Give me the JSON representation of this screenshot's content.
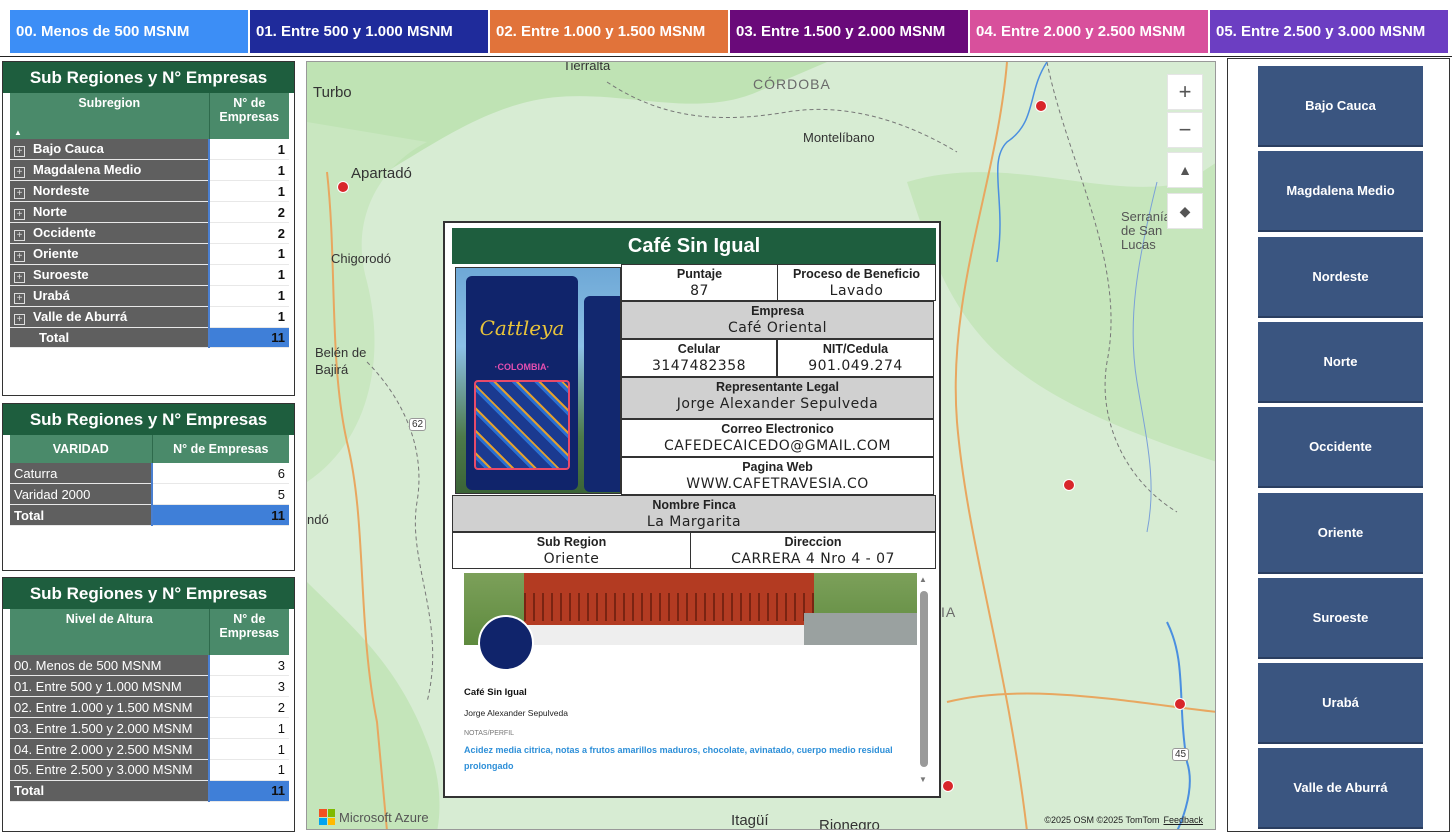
{
  "legend": [
    {
      "label": "00. Menos de 500 MSNM",
      "color": "#3c8ef6"
    },
    {
      "label": "01. Entre 500 y 1.000 MSNM",
      "color": "#1f2b9b"
    },
    {
      "label": "02. Entre 1.000 y 1.500 MSNM",
      "color": "#e1733a"
    },
    {
      "label": "03. Entre 1.500 y 2.000 MSNM",
      "color": "#6a0a7a"
    },
    {
      "label": "04. Entre 2.000 y 2.500 MSNM",
      "color": "#d8509c"
    },
    {
      "label": "05. Entre 2.500 y 3.000 MSNM",
      "color": "#6c3ec2"
    }
  ],
  "table1": {
    "title": "Sub Regiones y N° Empresas",
    "col1": "Subregion",
    "col2": "N° de Empresas",
    "rows": [
      {
        "label": "Bajo Cauca",
        "value": "1"
      },
      {
        "label": "Magdalena Medio",
        "value": "1"
      },
      {
        "label": "Nordeste",
        "value": "1"
      },
      {
        "label": "Norte",
        "value": "2"
      },
      {
        "label": "Occidente",
        "value": "2"
      },
      {
        "label": "Oriente",
        "value": "1"
      },
      {
        "label": "Suroeste",
        "value": "1"
      },
      {
        "label": "Urabá",
        "value": "1"
      },
      {
        "label": "Valle de Aburrá",
        "value": "1"
      }
    ],
    "total_label": "Total",
    "total_value": "11"
  },
  "table2": {
    "title": "Sub Regiones y N° Empresas",
    "col1": "VARIDAD",
    "col2": "N° de Empresas",
    "rows": [
      {
        "label": "Caturra",
        "value": "6"
      },
      {
        "label": "Varidad 2000",
        "value": "5"
      }
    ],
    "total_label": "Total",
    "total_value": "11"
  },
  "table3": {
    "title": "Sub Regiones y N° Empresas",
    "col1": "Nivel de Altura",
    "col2": "N° de Empresas",
    "rows": [
      {
        "label": "00. Menos de 500 MSNM",
        "value": "3"
      },
      {
        "label": "01. Entre 500 y 1.000 MSNM",
        "value": "3"
      },
      {
        "label": "02. Entre 1.000 y 1.500 MSNM",
        "value": "2"
      },
      {
        "label": "03. Entre 1.500 y 2.000 MSNM",
        "value": "1"
      },
      {
        "label": "04. Entre 2.000 y 2.500 MSNM",
        "value": "1"
      },
      {
        "label": "05. Entre 2.500 y 3.000 MSNM",
        "value": "1"
      }
    ],
    "total_label": "Total",
    "total_value": "11"
  },
  "map": {
    "labels": {
      "tierralta": "Tierralta",
      "cordoba": "CÓRDOBA",
      "turbo": "Turbo",
      "montelibano": "Montelíbano",
      "apartado": "Apartadó",
      "chigorodo": "Chigorodó",
      "belen": "Belén de Bajirá",
      "serrania": "Serranía de San Lucas",
      "route62": "62",
      "route45": "45",
      "ndo": "ndó",
      "ia": "IA",
      "itagui": "Itagüí",
      "rionegro": "Rionegro"
    },
    "zoom_in": "+",
    "zoom_out": "−",
    "attribution": "©2025 OSM  ©2025 TomTom",
    "feedback": "Feedback",
    "provider": "Microsoft Azure"
  },
  "card": {
    "title": "Café Sin Igual",
    "puntaje_label": "Puntaje",
    "puntaje": "87",
    "proceso_label": "Proceso de Beneficio",
    "proceso": "Lavado",
    "empresa_label": "Empresa",
    "empresa": "Café Oriental",
    "celular_label": "Celular",
    "celular": "3147482358",
    "nit_label": "NIT/Cedula",
    "nit": "901.049.274",
    "rep_label": "Representante Legal",
    "rep": "Jorge Alexander Sepulveda",
    "correo_label": "Correo Electronico",
    "correo": "CAFEDECAICEDO@GMAIL.COM",
    "web_label": "Pagina Web",
    "web": "WWW.CAFETRAVESIA.CO",
    "finca_label": "Nombre Finca",
    "finca": "La Margarita",
    "subregion_label": "Sub Region",
    "subregion": "Oriente",
    "direccion_label": "Direccion",
    "direccion": "CARRERA 4 Nro 4 - 07",
    "bag_brand": "Cattleya",
    "bag_sub": "·COLOMBIA·",
    "social_name": "Café Sin Igual",
    "social_rep": "Jorge Alexander Sepulveda",
    "notes_label": "NOTAS/PERFIL",
    "notes": "Acidez media citrica, notas a frutos amarillos maduros, chocolate, avinatado, cuerpo medio residual prolongado"
  },
  "slicers": [
    "Bajo Cauca",
    "Magdalena Medio",
    "Nordeste",
    "Norte",
    "Occidente",
    "Oriente",
    "Suroeste",
    "Urabá",
    "Valle de Aburrá"
  ]
}
